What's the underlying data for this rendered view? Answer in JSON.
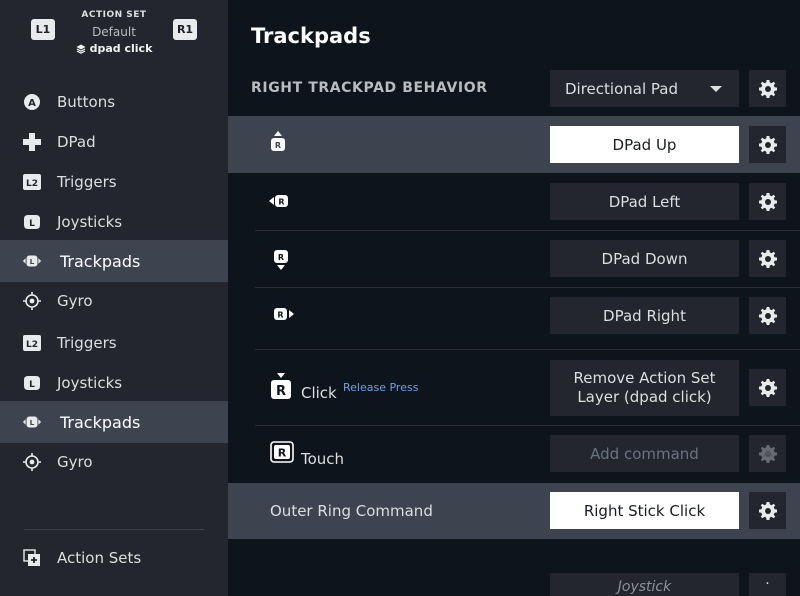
{
  "sidebar": {
    "header": {
      "left_shoulder": "L1",
      "right_shoulder": "R1",
      "label": "ACTION SET",
      "set_name": "Default",
      "layer_name": "dpad click"
    },
    "items": [
      {
        "label": "Buttons",
        "icon": "a-button-icon"
      },
      {
        "label": "DPad",
        "icon": "dpad-icon"
      },
      {
        "label": "Triggers",
        "icon": "l2-trigger-icon"
      },
      {
        "label": "Joysticks",
        "icon": "joystick-icon"
      },
      {
        "label": "Trackpads",
        "icon": "trackpad-icon",
        "active": true
      },
      {
        "label": "Gyro",
        "icon": "gyro-icon"
      },
      {
        "label": "Triggers",
        "icon": "l2-trigger-icon"
      },
      {
        "label": "Joysticks",
        "icon": "joystick-icon"
      },
      {
        "label": "Trackpads",
        "icon": "trackpad-icon",
        "active": true
      },
      {
        "label": "Gyro",
        "icon": "gyro-icon"
      }
    ],
    "footer": {
      "label": "Action Sets",
      "icon": "action-sets-icon"
    }
  },
  "main": {
    "title": "Trackpads",
    "section_heading": "RIGHT TRACKPAD BEHAVIOR",
    "behavior_value": "Directional Pad",
    "rows": [
      {
        "name": "up",
        "command": "DPad Up"
      },
      {
        "name": "left",
        "command": "DPad Left"
      },
      {
        "name": "down",
        "command": "DPad Down"
      },
      {
        "name": "right",
        "command": "DPad Right"
      },
      {
        "name": "click",
        "label": "Click",
        "mode": "Release Press",
        "command": "Remove Action Set Layer (dpad click)"
      },
      {
        "name": "touch",
        "label": "Touch",
        "command": "Add command"
      },
      {
        "name": "outer-ring",
        "label": "Outer Ring Command",
        "command": "Right Stick Click"
      }
    ],
    "next_section_partial": "Joystick",
    "badge_letter": "R"
  },
  "colors": {
    "sidebar_bg": "#23262e",
    "main_bg": "#0e141b",
    "highlight": "#3d4450",
    "button_bg": "#23262e",
    "selected_button_bg": "#ffffff",
    "link_blue": "#6aa3e0"
  }
}
